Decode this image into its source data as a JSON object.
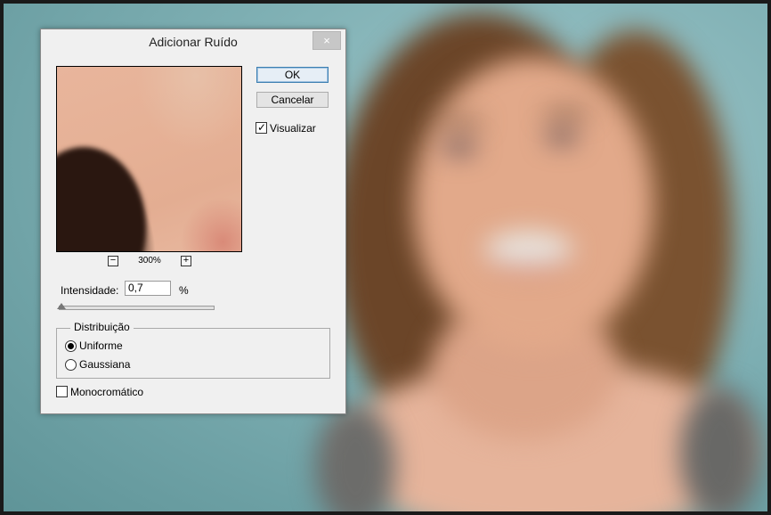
{
  "dialog": {
    "title": "Adicionar Ruído",
    "close_icon": "×",
    "zoom": {
      "level": "300%",
      "zoom_out": "−",
      "zoom_in": "+"
    },
    "buttons": {
      "ok": "OK",
      "cancel": "Cancelar"
    },
    "preview_checkbox": {
      "label": "Visualizar",
      "checked": true,
      "mark": "✓"
    },
    "intensity": {
      "label": "Intensidade:",
      "value": "0,7",
      "unit": "%",
      "slider_level": 0.007
    },
    "distribution": {
      "legend": "Distribuição",
      "options": [
        {
          "label": "Uniforme",
          "selected": true
        },
        {
          "label": "Gaussiana",
          "selected": false
        }
      ]
    },
    "monochromatic": {
      "label": "Monocromático",
      "checked": false
    }
  },
  "background": {
    "description_icon": "photo-canvas",
    "accent": "#7fb0b4"
  }
}
